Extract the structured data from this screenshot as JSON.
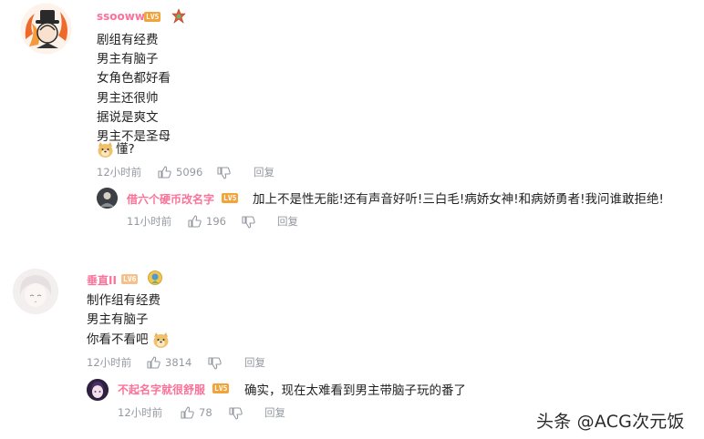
{
  "comments": [
    {
      "username": "ssooww",
      "level": "LV5",
      "lines": [
        "剧组有经费",
        "男主有脑子",
        "女角色都好看",
        "男主还很帅",
        "据说是爽文",
        "男主不是圣母"
      ],
      "emoji_line": "懂?",
      "time": "12小时前",
      "likes": "5096",
      "reply_label": "回复",
      "reply": {
        "username": "借六个硬币改名字",
        "level": "LV5",
        "text": "加上不是性无能!还有声音好听!三白毛!病娇女神!和病娇勇者!我问谁敢拒绝!",
        "time": "11小时前",
        "likes": "196",
        "reply_label": "回复"
      }
    },
    {
      "username": "垂直II",
      "level": "LV6",
      "lines": [
        "制作组有经费",
        "男主有脑子"
      ],
      "emoji_line": "你看不看吧",
      "time": "12小时前",
      "likes": "3814",
      "reply_label": "回复",
      "reply": {
        "username": "不起名字就很舒服",
        "level": "LV5",
        "text": "确实，现在太难看到男主带脑子玩的番了",
        "time": "12小时前",
        "likes": "78",
        "reply_label": "回复"
      }
    }
  ],
  "watermark": "头条 @ACG次元饭",
  "colors": {
    "username_pink": "#fb7299",
    "meta_gray": "#9499a0",
    "level_orange": "#f2a33a"
  }
}
